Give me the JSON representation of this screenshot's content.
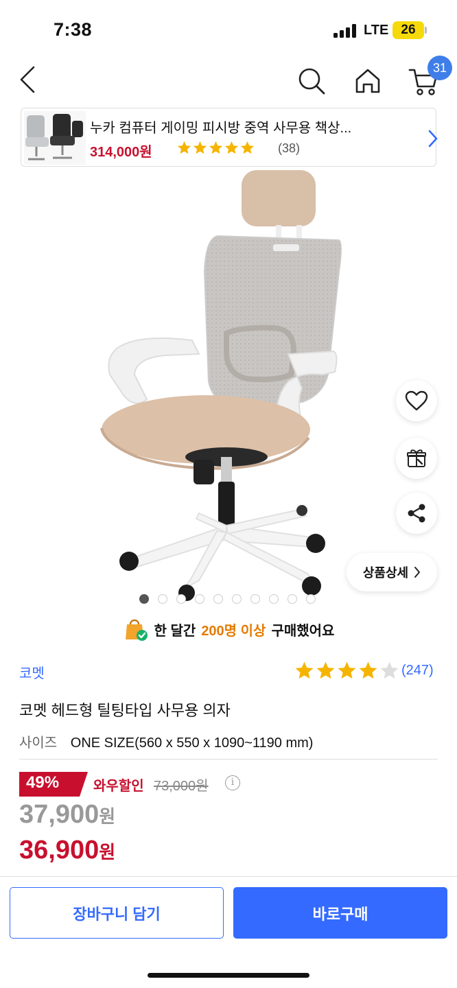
{
  "status_bar": {
    "time": "7:38",
    "network": "LTE",
    "battery": "26"
  },
  "nav": {
    "cart_count": "31"
  },
  "related_product": {
    "title": "누카 컴퓨터 게이밍 피시방 중역 사무용 책상...",
    "price": "314,000원",
    "rating": 5,
    "review_count": "(38)"
  },
  "gallery": {
    "image_count": 10,
    "active_index": 0
  },
  "side_actions": {
    "detail_label": "상품상세"
  },
  "purchase_note": {
    "prefix": "한 달간",
    "highlight": "200명 이상",
    "suffix": "구매했어요"
  },
  "product": {
    "brand": "코멧",
    "rating": 4,
    "review_count": "(247)",
    "title": "코멧 헤드형 틸팅타입 사무용 의자",
    "size_label": "사이즈",
    "size_value": "ONE SIZE(560 x 550 x 1090~1190 mm)"
  },
  "pricing": {
    "discount": "49%",
    "wow_label": "와우할인",
    "original_price": "73,000원",
    "sale_price": "37,900",
    "wow_price": "36,900",
    "currency": "원"
  },
  "actions": {
    "cart_label": "장바구니 담기",
    "buy_label": "바로구매"
  },
  "colors": {
    "accent": "#346aff",
    "price_red": "#c8102e",
    "star": "#f5b400",
    "badge_blue": "#3f7ee8"
  }
}
